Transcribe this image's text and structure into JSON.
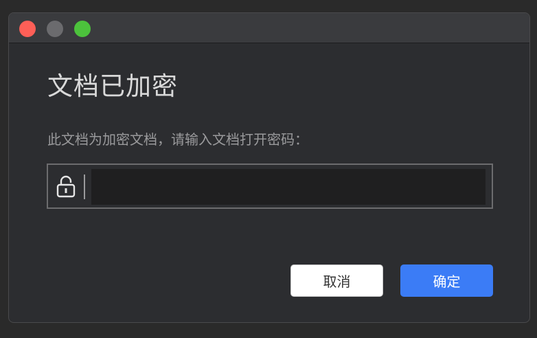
{
  "dialog": {
    "title": "文档已加密",
    "prompt": "此文档为加密文档，请输入文档打开密码：",
    "password_value": ""
  },
  "buttons": {
    "cancel_label": "取消",
    "ok_label": "确定"
  },
  "icons": {
    "lock": "lock-icon"
  },
  "colors": {
    "accent": "#3b7cf6",
    "close": "#ff5f57",
    "minimize": "#6b6b6e",
    "zoom": "#4cc23c"
  }
}
